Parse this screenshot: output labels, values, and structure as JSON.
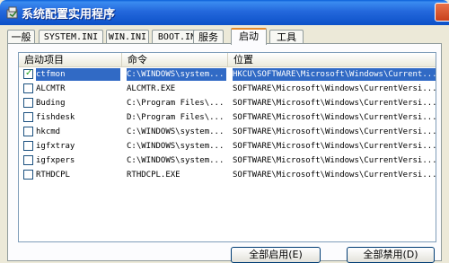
{
  "window": {
    "title": "系统配置实用程序"
  },
  "tabs": [
    {
      "label": "一般"
    },
    {
      "label": "SYSTEM.INI"
    },
    {
      "label": "WIN.INI"
    },
    {
      "label": "BOOT.INI"
    },
    {
      "label": "服务"
    },
    {
      "label": "启动"
    },
    {
      "label": "工具"
    }
  ],
  "active_tab": "启动",
  "startup_list": {
    "columns": [
      "启动项目",
      "命令",
      "位置"
    ],
    "rows": [
      {
        "checked": true,
        "name": "ctfmon",
        "command": "C:\\WINDOWS\\system...",
        "location": "HKCU\\SOFTWARE\\Microsoft\\Windows\\Current..."
      },
      {
        "checked": false,
        "name": "ALCMTR",
        "command": "ALCMTR.EXE",
        "location": "SOFTWARE\\Microsoft\\Windows\\CurrentVersi..."
      },
      {
        "checked": false,
        "name": "Buding",
        "command": "C:\\Program Files\\...",
        "location": "SOFTWARE\\Microsoft\\Windows\\CurrentVersi..."
      },
      {
        "checked": false,
        "name": "fishdesk",
        "command": "D:\\Program Files\\...",
        "location": "SOFTWARE\\Microsoft\\Windows\\CurrentVersi..."
      },
      {
        "checked": false,
        "name": "hkcmd",
        "command": "C:\\WINDOWS\\system...",
        "location": "SOFTWARE\\Microsoft\\Windows\\CurrentVersi..."
      },
      {
        "checked": false,
        "name": "igfxtray",
        "command": "C:\\WINDOWS\\system...",
        "location": "SOFTWARE\\Microsoft\\Windows\\CurrentVersi..."
      },
      {
        "checked": false,
        "name": "igfxpers",
        "command": "C:\\WINDOWS\\system...",
        "location": "SOFTWARE\\Microsoft\\Windows\\CurrentVersi..."
      },
      {
        "checked": false,
        "name": "RTHDCPL",
        "command": "RTHDCPL.EXE",
        "location": "SOFTWARE\\Microsoft\\Windows\\CurrentVersi..."
      }
    ],
    "selected_row": 0
  },
  "buttons": {
    "enable_all": "全部启用(E)",
    "disable_all": "全部禁用(D)"
  },
  "icons": {
    "app": "msconfig-app-icon",
    "close": "close-icon",
    "checkbox_checked": "checkmark-icon"
  },
  "colors": {
    "titlebar": "#0c51c8",
    "selection": "#316ac5",
    "active_tab_accent": "#e68b2c",
    "dialog_bg": "#ece9d8"
  }
}
